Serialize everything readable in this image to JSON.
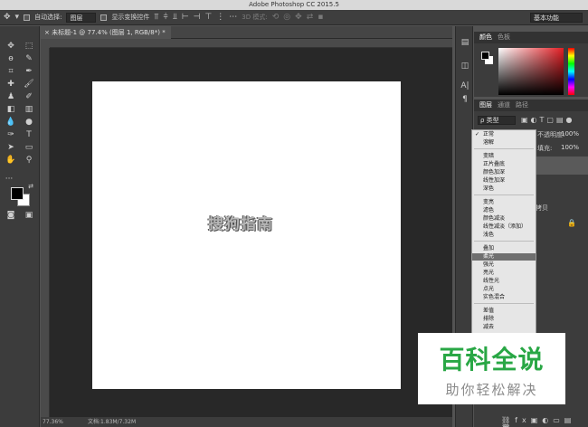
{
  "app": {
    "title": "Adobe Photoshop CC 2015.5"
  },
  "options_bar": {
    "auto_select_label": "自动选择:",
    "auto_select_value": "图层",
    "show_transform_label": "显示变换控件",
    "three_d_label": "3D 模式:",
    "workspace": "基本功能"
  },
  "document": {
    "tab_label": "未标题-1 @ 77.4% (图层 1, RGB/8*) *",
    "canvas_text": "搜狗指南"
  },
  "status": {
    "zoom": "77.36%",
    "doc_info": "文档:1.83M/7.32M"
  },
  "color_panel": {
    "tabs": [
      "颜色",
      "色板"
    ]
  },
  "layers_panel": {
    "tabs": [
      "图层",
      "通道",
      "路径"
    ],
    "filter_label": "ρ 类型",
    "opacity_label": "不透明度:",
    "opacity_value": "100%",
    "fill_label": "填充:",
    "fill_value": "100%",
    "layer_copy_label": "拷贝"
  },
  "blend_modes": {
    "current": "正常",
    "items": [
      "正常",
      "溶解",
      "变暗",
      "正片叠底",
      "颜色加深",
      "线性加深",
      "深色",
      "变亮",
      "滤色",
      "颜色减淡",
      "线性减淡（添加）",
      "浅色",
      "叠加",
      "柔光",
      "强光",
      "亮光",
      "线性光",
      "点光",
      "实色混合",
      "差值",
      "排除",
      "减去"
    ],
    "highlighted": "柔光"
  },
  "watermark": {
    "title": "百科全说",
    "subtitle": "助你轻松解决"
  },
  "colors": {
    "accent_green": "#29a745",
    "foreground": "#000000",
    "background": "#ffffff"
  }
}
